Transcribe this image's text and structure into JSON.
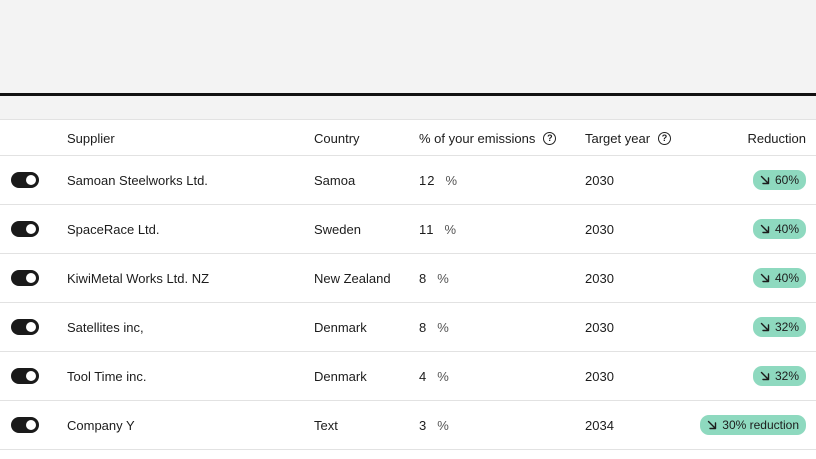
{
  "table": {
    "headers": {
      "supplier": "Supplier",
      "country": "Country",
      "emissions": "% of your emissions",
      "target_year": "Target year",
      "reduction": "Reduction"
    },
    "help_glyph": "?",
    "rows": [
      {
        "supplier": "Samoan Steelworks Ltd.",
        "country": "Samoa",
        "emissions": "12",
        "unit": "%",
        "target_year": "2030",
        "reduction": "60%",
        "enabled": true
      },
      {
        "supplier": "SpaceRace Ltd.",
        "country": "Sweden",
        "emissions": "11",
        "unit": "%",
        "target_year": "2030",
        "reduction": "40%",
        "enabled": true
      },
      {
        "supplier": "KiwiMetal Works Ltd. NZ",
        "country": "New Zealand",
        "emissions": "8",
        "unit": "%",
        "target_year": "2030",
        "reduction": "40%",
        "enabled": true
      },
      {
        "supplier": "Satellites inc,",
        "country": "Denmark",
        "emissions": "8",
        "unit": "%",
        "target_year": "2030",
        "reduction": "32%",
        "enabled": true
      },
      {
        "supplier": "Tool Time inc.",
        "country": "Denmark",
        "emissions": "4",
        "unit": "%",
        "target_year": "2030",
        "reduction": "32%",
        "enabled": true
      },
      {
        "supplier": "Company Y",
        "country": "Text",
        "emissions": "3",
        "unit": "%",
        "target_year": "2034",
        "reduction": "30% reduction",
        "enabled": true
      }
    ]
  },
  "colors": {
    "badge": "#8ed9bf",
    "toggle_on": "#1a1a1a",
    "panel": "#f3f3f3"
  },
  "icons": {
    "reduction_arrow": "arrow-down-right-icon",
    "help": "help-circle-icon"
  }
}
